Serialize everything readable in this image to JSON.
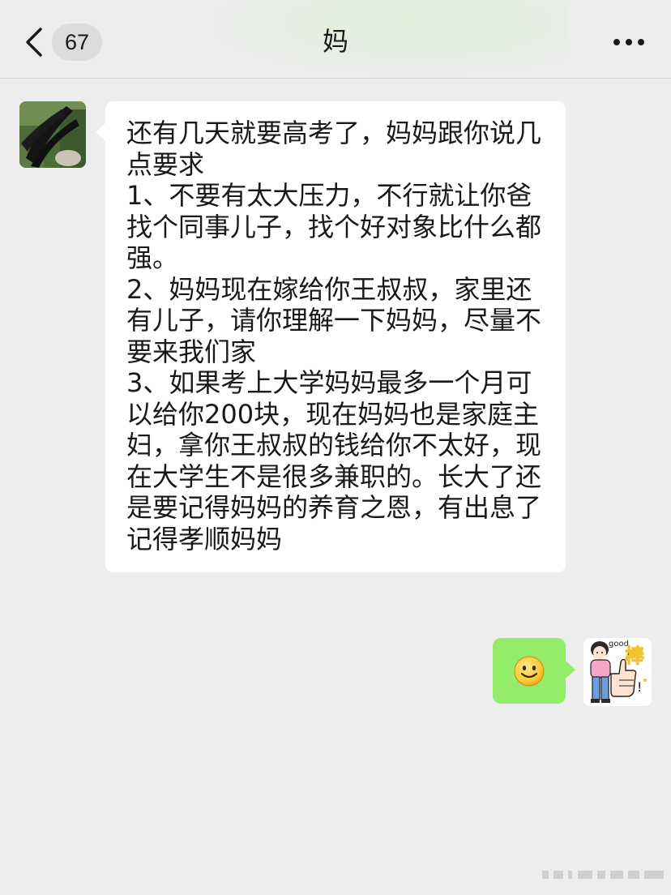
{
  "header": {
    "unread_count": "67",
    "title": "妈"
  },
  "messages": [
    {
      "side": "left",
      "sender": "妈",
      "text": "还有几天就要高考了，妈妈跟你说几点要求\n1、不要有太大压力，不行就让你爸找个同事儿子，找个好对象比什么都强。\n2、妈妈现在嫁给你王叔叔，家里还有儿子，请你理解一下妈妈，尽量不要来我们家\n3、如果考上大学妈妈最多一个月可以给你200块，现在妈妈也是家庭主妇，拿你王叔叔的钱给你不太好，现在大学生不是很多兼职的。长大了还是要记得妈妈的养育之恩，有出息了记得孝顺妈妈"
    },
    {
      "side": "right",
      "content": "smile-emoji"
    }
  ],
  "avatar_sticker": {
    "caption": "good",
    "glyph": "棒"
  },
  "colors": {
    "background": "#ededed",
    "incoming_bubble": "#ffffff",
    "outgoing_bubble": "#95ec69"
  }
}
